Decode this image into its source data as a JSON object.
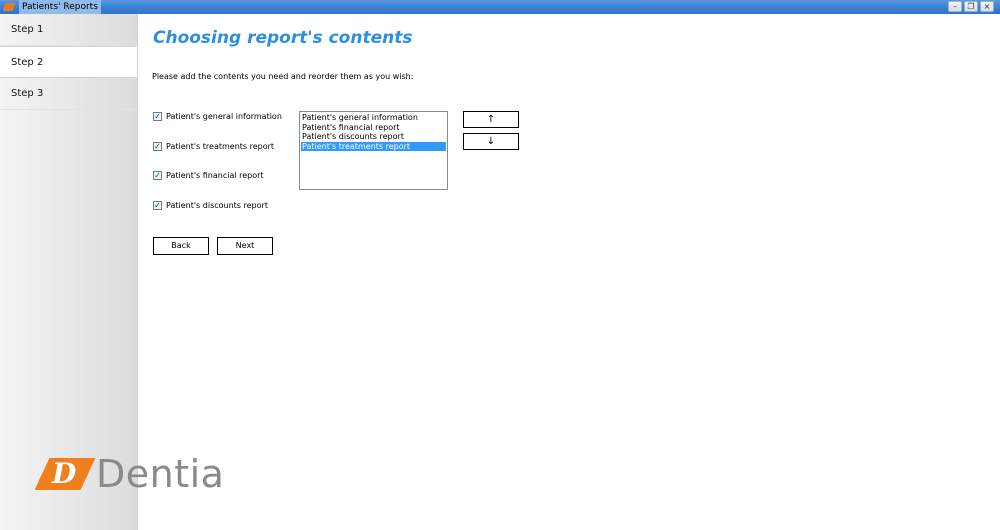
{
  "window": {
    "title": "Patients' Reports",
    "controls": {
      "minimize": "–",
      "restore": "❐",
      "close": "×"
    }
  },
  "sidebar": {
    "steps": [
      {
        "label": "Step 1",
        "active": false
      },
      {
        "label": "Step 2",
        "active": true
      },
      {
        "label": "Step 3",
        "active": false
      }
    ],
    "logo": {
      "mark_letter": "D",
      "text": "Dentia",
      "mark_color": "#f07f1e",
      "text_color": "#8a8a8a"
    }
  },
  "main": {
    "title": "Choosing report's contents",
    "title_color": "#2e8ee0",
    "instruction": "Please add the contents you need and reorder them as you wish:",
    "checkboxes": [
      {
        "label": "Patient's general information",
        "checked": true
      },
      {
        "label": "Patient's treatments report",
        "checked": true
      },
      {
        "label": "Patient's financial report",
        "checked": true
      },
      {
        "label": "Patient's discounts report",
        "checked": true
      }
    ],
    "order_list": [
      {
        "label": "Patient's general information",
        "selected": false
      },
      {
        "label": "Patient's financial report",
        "selected": false
      },
      {
        "label": "Patient's discounts report",
        "selected": false
      },
      {
        "label": "Patient's treatments report",
        "selected": true
      }
    ],
    "move_up_label": "↑",
    "move_down_label": "↓",
    "back_label": "Back",
    "next_label": "Next",
    "selection_color": "#3399ff"
  }
}
